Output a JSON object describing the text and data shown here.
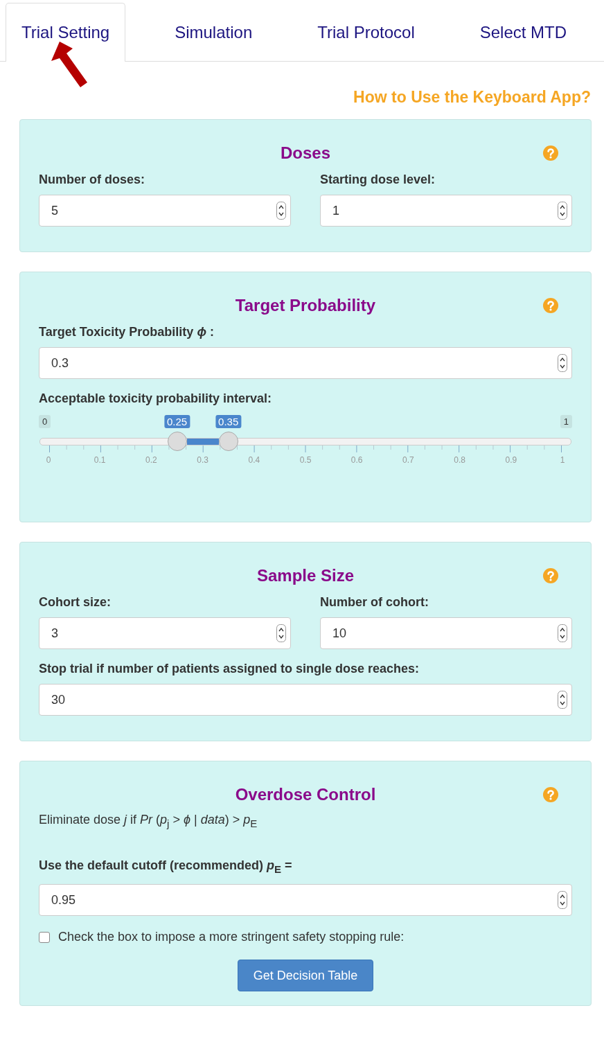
{
  "tabs": [
    {
      "label": "Trial Setting",
      "selected": true
    },
    {
      "label": "Simulation",
      "selected": false
    },
    {
      "label": "Trial Protocol",
      "selected": false
    },
    {
      "label": "Select MTD",
      "selected": false
    }
  ],
  "help_link": "How to Use the Keyboard App?",
  "panels": [
    {
      "title": "Doses",
      "items": [
        {
          "kind": "pair",
          "fields": [
            {
              "label": "Number of doses:",
              "value": "5"
            },
            {
              "label": "Starting dose level:",
              "value": "1"
            }
          ]
        }
      ]
    },
    {
      "title": "Target Probability",
      "items": [
        {
          "kind": "field",
          "label": "Target Toxicity Probability *ϕ* :",
          "value": "0.3"
        },
        {
          "kind": "slider",
          "label": "Acceptable toxicity probability interval:",
          "min_label": "0",
          "max_label": "1",
          "low": {
            "level": 0.25,
            "label": "0.25"
          },
          "high": {
            "level": 0.35,
            "label": "0.35"
          },
          "ticks": [
            "0",
            "0.1",
            "0.2",
            "0.3",
            "0.4",
            "0.5",
            "0.6",
            "0.7",
            "0.8",
            "0.9",
            "1"
          ]
        }
      ]
    },
    {
      "title": "Sample Size",
      "items": [
        {
          "kind": "pair",
          "fields": [
            {
              "label": "Cohort size:",
              "value": "3"
            },
            {
              "label": "Number of cohort:",
              "value": "10"
            }
          ]
        },
        {
          "kind": "field",
          "label": "Stop trial if number of patients assigned to single dose reaches:",
          "value": "30"
        }
      ]
    },
    {
      "title": "Overdose Control",
      "items": [
        {
          "kind": "note",
          "text": "Eliminate dose *j* if *Pr* (*p*$_{j}$ > *ϕ* | *data*) > *p*$_{E}$"
        },
        {
          "kind": "field",
          "label": "Use the default cutoff (recommended) *p*$_{E}$ =",
          "value": "0.95"
        },
        {
          "kind": "checkbox",
          "label": "Check the box to impose a more stringent safety stopping rule:",
          "checked": false
        },
        {
          "kind": "button",
          "label": "Get Decision Table"
        }
      ]
    }
  ]
}
